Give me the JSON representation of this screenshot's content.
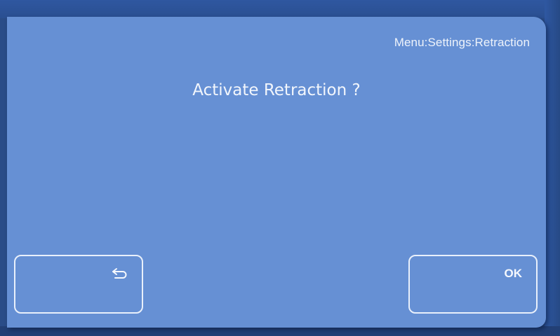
{
  "header": {
    "breadcrumb": "Menu:Settings:Retraction"
  },
  "dialog": {
    "prompt": "Activate Retraction ?"
  },
  "softkeys": {
    "back": {
      "icon": "return-arrow-icon"
    },
    "ok": {
      "label": "OK"
    }
  },
  "colors": {
    "screen_background": "#6690d4",
    "frame": "#2a4c87",
    "text": "#f2f6fc"
  }
}
